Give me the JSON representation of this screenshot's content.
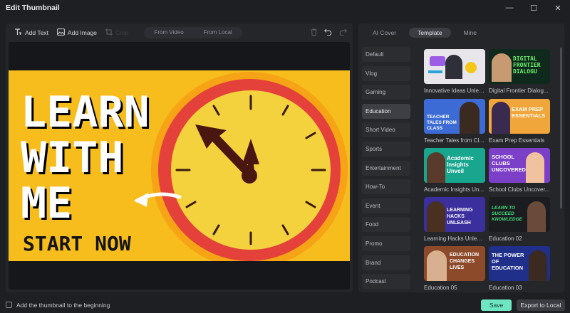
{
  "window": {
    "title": "Edit Thumbnail",
    "minimize_glyph": "—",
    "maximize_glyph": "☐",
    "close_glyph": "✕"
  },
  "toolbar": {
    "add_text": "Add Text",
    "add_image": "Add Image",
    "crop_label": "Crop",
    "from_video": "From Video",
    "from_local": "From Local"
  },
  "thumbnail": {
    "line1": "LEARN",
    "line2": "WITH",
    "line3": "ME",
    "line4": "START NOW",
    "background_color": "#f6bd1c",
    "clock_rim_color": "#e4413a",
    "clock_face_color": "#f5cf3a"
  },
  "right_tabs": [
    "AI Cover",
    "Template",
    "Mine"
  ],
  "categories": [
    "Default",
    "Vlog",
    "Gaming",
    "Education",
    "Short Video",
    "Sports",
    "Entertainment",
    "How-To",
    "Event",
    "Food",
    "Promo",
    "Brand",
    "Podcast"
  ],
  "selected_category": "Education",
  "templates": [
    {
      "label": "Innovative Ideas Unlea...",
      "art": "",
      "bg": "#e8e6ea"
    },
    {
      "label": "Digital Frontier Dialog...",
      "art": "DIGITAL FRONTIER DIALOGU",
      "bg": "#0f2a1c"
    },
    {
      "label": "Teacher Tales from Class",
      "art": "TEACHER TALES FROM CLASS",
      "bg": "#3d6bd6"
    },
    {
      "label": "Exam Prep Essentials",
      "art": "EXAM PREP ESSENTIALS",
      "bg": "#f0a63a"
    },
    {
      "label": "Academic Insights Un...",
      "art": "Academic Insights Unveil",
      "bg": "#18a68f"
    },
    {
      "label": "School Clubs Uncover...",
      "art": "SCHOOL CLUBS UNCOVERED",
      "bg": "#7b3fc8"
    },
    {
      "label": "Learning Hacks Unleas...",
      "art": "LEARNING HACKS UNLEASH",
      "bg": "#3a2f9c"
    },
    {
      "label": "Education 02",
      "art": "LEARN TO SUCCEED KNOWLEDGE",
      "bg": "#1a1c1f"
    },
    {
      "label": "Education 05",
      "art": "EDUCATION CHANGES LIVES",
      "bg": "#8c4a2a"
    },
    {
      "label": "Education 03",
      "art": "THE POWER OF EDUCATION",
      "bg": "#1f2f8a"
    }
  ],
  "footer": {
    "checkbox_label": "Add the thumbnail to the beginning",
    "save": "Save",
    "export": "Export to Local"
  }
}
